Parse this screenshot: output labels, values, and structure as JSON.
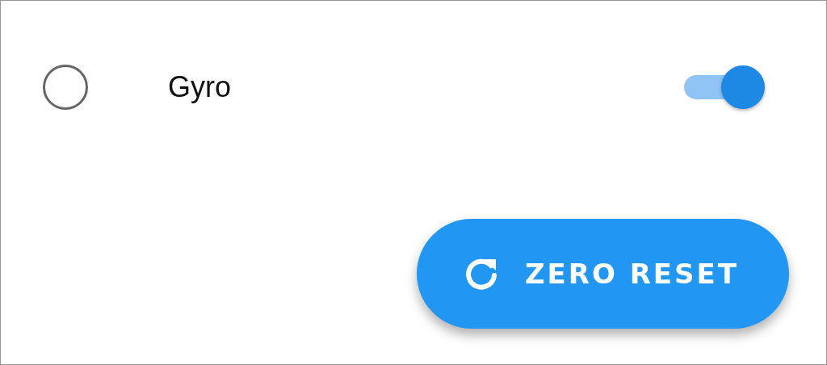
{
  "row": {
    "radio": {
      "selected": false
    },
    "label": "Gyro",
    "toggle": {
      "on": true
    }
  },
  "button": {
    "label": "ZERO RESET"
  }
}
